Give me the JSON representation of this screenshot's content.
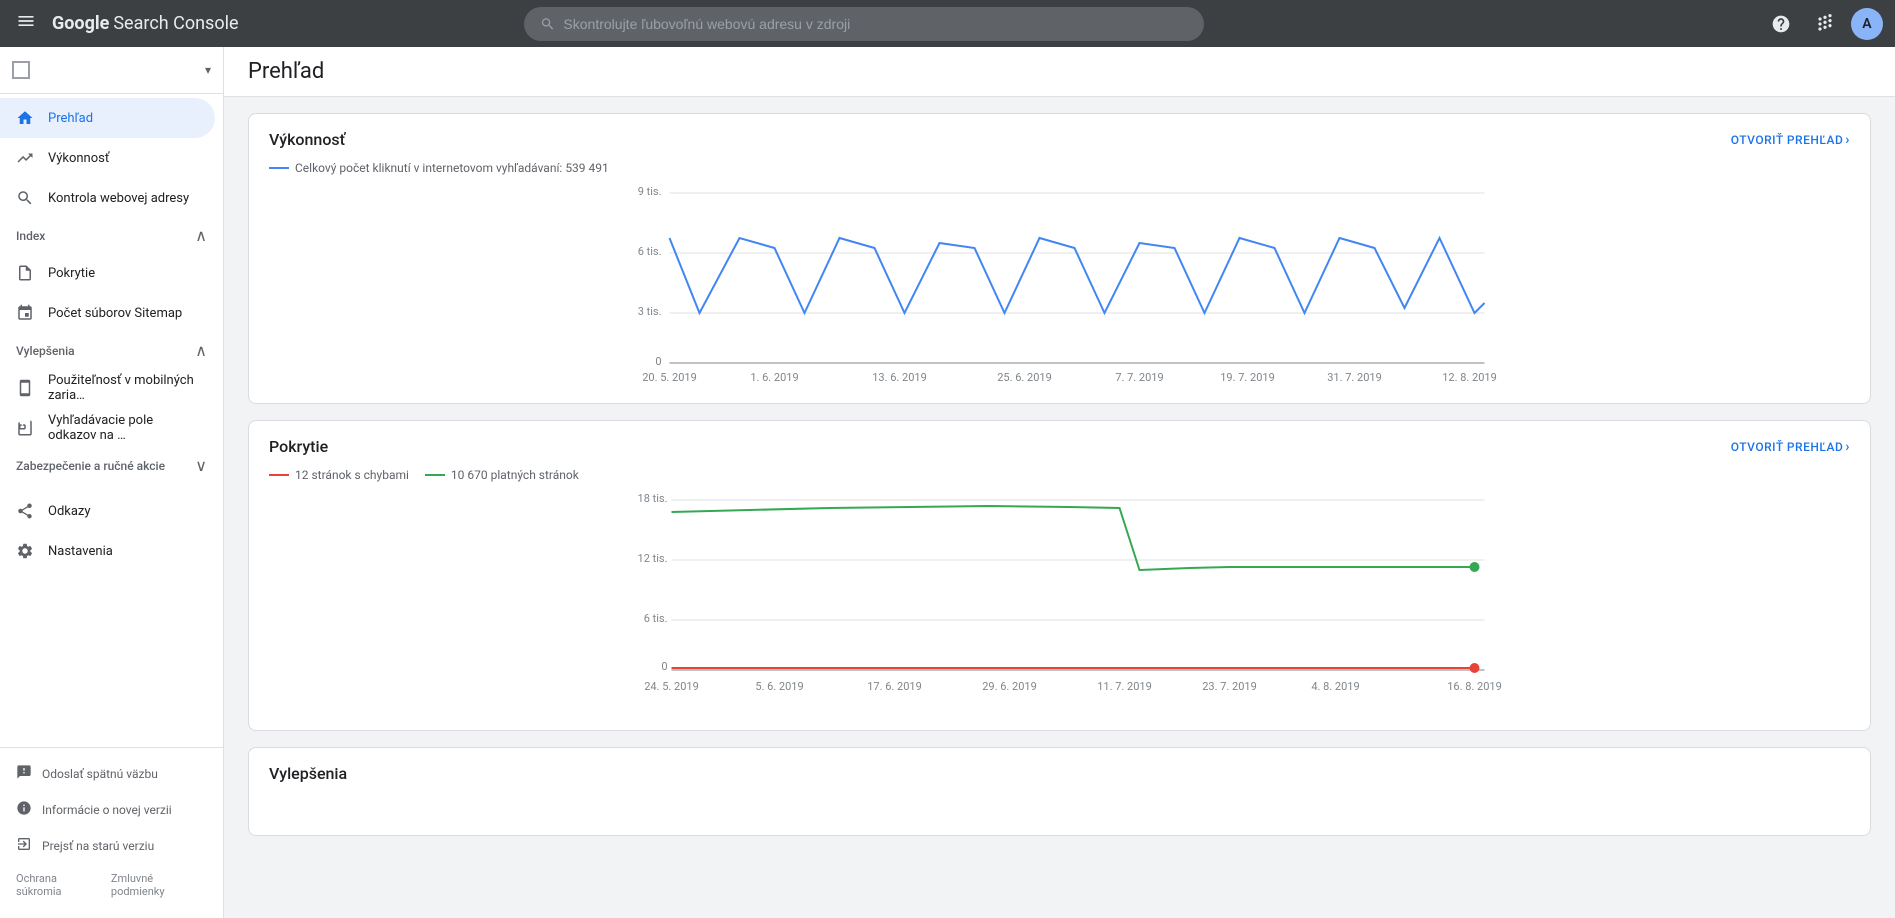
{
  "topbar": {
    "menu_label": "☰",
    "logo_google": "Google",
    "logo_product": "Search Console",
    "search_placeholder": "Skontrolujte ľubovoľnú webovú adresu v zdroji",
    "help_icon": "?",
    "apps_icon": "⠿",
    "avatar_letter": "A"
  },
  "sidebar": {
    "property_placeholder": "",
    "nav_items": [
      {
        "id": "prehlad",
        "label": "Prehľad",
        "icon": "home",
        "active": true
      },
      {
        "id": "vykonnost",
        "label": "Výkonnosť",
        "icon": "trending_up",
        "active": false
      },
      {
        "id": "kontrola",
        "label": "Kontrola webovej adresy",
        "icon": "search",
        "active": false
      }
    ],
    "index_section": "Index",
    "index_items": [
      {
        "id": "pokrytie",
        "label": "Pokrytie",
        "icon": "file"
      },
      {
        "id": "sitemap",
        "label": "Počet súborov Sitemap",
        "icon": "sitemap"
      }
    ],
    "vylepsenia_section": "Vylepšenia",
    "vylepsenia_items": [
      {
        "id": "mobilne",
        "label": "Použiteľnosť v mobilných zaria…",
        "icon": "mobile"
      },
      {
        "id": "vyhladavacie",
        "label": "Vyhľadávacie pole odkazov na …",
        "icon": "search-box"
      }
    ],
    "zabezpecenie_section": "Zabezpečenie a ručné akcie",
    "footer_items": [
      {
        "id": "odkazy",
        "label": "Odkazy",
        "icon": "share"
      },
      {
        "id": "nastavenia",
        "label": "Nastavenia",
        "icon": "settings"
      }
    ],
    "bottom_items": [
      {
        "id": "spatna-vazba",
        "label": "Odoslať spätnú väzbu",
        "icon": "feedback"
      },
      {
        "id": "nova-verzia",
        "label": "Informácie o novej verzii",
        "icon": "info"
      },
      {
        "id": "stara-verzia",
        "label": "Prejsť na starú verziu",
        "icon": "exit"
      }
    ],
    "legal": {
      "privacy": "Ochrana súkromia",
      "terms": "Zmluvné podmienky"
    }
  },
  "page": {
    "title": "Prehľad"
  },
  "performance_card": {
    "title": "Výkonnosť",
    "link_text": "OTVORIŤ PREHĽAD",
    "legend_label": "Celkový počet kliknutí v internetovom vyhľadávaní: 539 491",
    "legend_color": "#4285f4",
    "y_labels": [
      "9 tis.",
      "6 tis.",
      "3 tis.",
      "0"
    ],
    "x_labels": [
      "20. 5. 2019",
      "1. 6. 2019",
      "13. 6. 2019",
      "25. 6. 2019",
      "7. 7. 2019",
      "19. 7. 2019",
      "31. 7. 2019",
      "12. 8. 2019"
    ]
  },
  "pokrytie_card": {
    "title": "Pokrytie",
    "link_text": "OTVORIŤ PREHĽAD",
    "legend_errors_label": "12 stránok s chybami",
    "legend_errors_color": "#ea4335",
    "legend_valid_label": "10 670 platných stránok",
    "legend_valid_color": "#34a853",
    "y_labels": [
      "18 tis.",
      "12 tis.",
      "6 tis.",
      "0"
    ],
    "x_labels": [
      "24. 5. 2019",
      "5. 6. 2019",
      "17. 6. 2019",
      "29. 6. 2019",
      "11. 7. 2019",
      "23. 7. 2019",
      "4. 8. 2019",
      "16. 8. 2019"
    ]
  },
  "vylepsenia_card": {
    "title": "Vylepšenia"
  }
}
